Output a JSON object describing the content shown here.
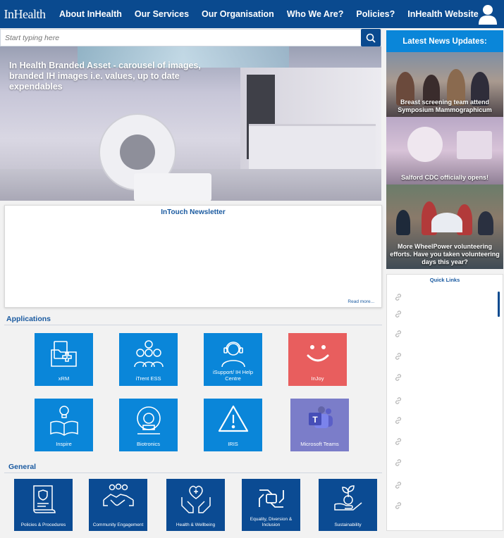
{
  "nav": {
    "logo": "InHealth",
    "items": [
      "About InHealth",
      "Our Services",
      "Our Organisation",
      "Who We Are?",
      "Policies?",
      "InHealth Website"
    ]
  },
  "search": {
    "placeholder": "Start typing here"
  },
  "hero": {
    "caption": "In Health Branded Asset - carousel of images, branded IH images i.e. values, up to date expendables"
  },
  "newsletter": {
    "title": "InTouch Newsletter",
    "read_more": "Read more..."
  },
  "applications": {
    "title": "Applications",
    "tiles": [
      {
        "label": "xRM",
        "icon": "folder-medical-icon"
      },
      {
        "label": "iTrent ESS",
        "icon": "team-gear-icon"
      },
      {
        "label": "iSupport/ IH Help Centre",
        "icon": "headset-icon"
      },
      {
        "label": "InJoy",
        "icon": "smiley-icon"
      },
      {
        "label": "Inspire",
        "icon": "book-bulb-icon"
      },
      {
        "label": "Biotronics",
        "icon": "scanner-icon"
      },
      {
        "label": "IRIS",
        "icon": "warning-icon"
      },
      {
        "label": "Microsoft Teams",
        "icon": "teams-icon"
      }
    ]
  },
  "general": {
    "title": "General",
    "tiles": [
      {
        "label": "Policies & Procedures",
        "icon": "policy-scroll-icon"
      },
      {
        "label": "Community Engagement",
        "icon": "handshake-icon"
      },
      {
        "label": "Health & Wellbeing",
        "icon": "heart-hands-icon"
      },
      {
        "label": "Equality, Diversion & Inclusion",
        "icon": "linked-hands-icon"
      },
      {
        "label": "Sustainability",
        "icon": "plant-hand-icon"
      }
    ]
  },
  "news": {
    "title": "Latest News Updates:",
    "items": [
      {
        "caption": "Breast screening team attend Symposium Mammographicum"
      },
      {
        "caption": "Salford CDC officially opens!"
      },
      {
        "caption": "More WheelPower volunteering efforts. Have you taken volunteering days this year?"
      }
    ]
  },
  "quick_links": {
    "title": "Quick Links",
    "count": 11
  },
  "colors": {
    "nav": "#0a4a8f",
    "accent": "#0a86d9",
    "general_tile": "#0b4b93",
    "injoy": "#e85e5e",
    "teams": "#7b7dc9"
  }
}
